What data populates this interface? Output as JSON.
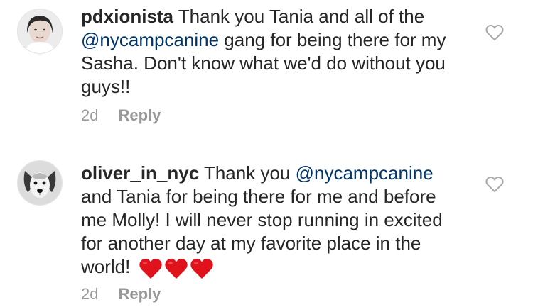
{
  "comments": [
    {
      "username": "pdxionista",
      "text_parts": [
        {
          "type": "text",
          "value": " Thank you Tania and all of the "
        },
        {
          "type": "mention",
          "value": "@nycampcanine"
        },
        {
          "type": "text",
          "value": " gang for being there for my Sasha. Don't know what we'd do without you guys!!"
        }
      ],
      "time": "2d",
      "reply_label": "Reply",
      "avatar_icon": "woman-avatar",
      "like_icon": "heart-outline-icon"
    },
    {
      "username": "oliver_in_nyc",
      "text_parts": [
        {
          "type": "text",
          "value": " Thank you "
        },
        {
          "type": "mention",
          "value": "@nycampcanine"
        },
        {
          "type": "text",
          "value": " and Tania for being there for me and before me Molly!  I will never stop running in excited for another day at my favorite place in the world! "
        }
      ],
      "emoji": [
        "red-heart",
        "red-heart",
        "red-heart"
      ],
      "time": "2d",
      "reply_label": "Reply",
      "avatar_icon": "dog-avatar",
      "like_icon": "heart-outline-icon"
    }
  ],
  "colors": {
    "text": "#262626",
    "mention": "#003569",
    "meta": "#999999",
    "heart_emoji": "#e0131d"
  }
}
